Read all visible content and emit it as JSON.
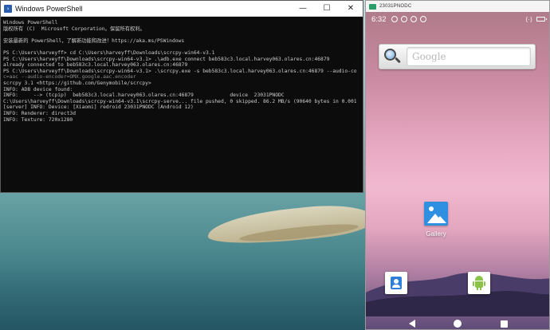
{
  "powershell": {
    "title": "Windows PowerShell",
    "controls": {
      "minimize": "—",
      "maximize": "☐",
      "close": "✕"
    },
    "lines": [
      "Windows PowerShell",
      "版权所有 (C)  Microsoft Corporation。保留所有权利。",
      "",
      "安装最新的 PowerShell，了解新功能和改进！https://aka.ms/PSWindows",
      "",
      "PS C:\\Users\\harveyff> cd C:\\Users\\harveyff\\Downloads\\scrcpy-win64-v3.1",
      "PS C:\\Users\\harveyff\\Downloads\\scrcpy-win64-v3.1> .\\adb.exe connect beb583c3.local.harvey063.olares.cn:46879",
      "already connected to beb583c3.local.harvey063.olares.cn:46879",
      "PS C:\\Users\\harveyff\\Downloads\\scrcpy-win64-v3.1> .\\scrcpy.exe -s beb583c3.local.harvey063.olares.cn:46879 --audio-code",
      "c=aac --audio-encoder=OMX.google.aac.encoder",
      "scrcpy 3.1 <https://github.com/Genymobile/scrcpy>",
      "INFO: ADB device found:",
      "INFO:     --> (tcpip)  beb583c3.local.harvey063.olares.cn:46879            device  23031PNODC",
      "C:\\Users\\harveyff\\Downloads\\scrcpy-win64-v3.1\\scrcpy-serve... file pushed, 0 skipped. 86.2 MB/s (90640 bytes in 0.001s)",
      "[server] INFO: Device: [Xiaomi] redroid 23031PNODC (Android 12)",
      "INFO: Renderer: direct3d",
      "INFO: Texture: 720x1280"
    ]
  },
  "android": {
    "window_title": "23031PNODC",
    "status": {
      "time": "6:32",
      "right_text": "⟨·⟩"
    },
    "search": {
      "placeholder": "Google"
    },
    "apps": {
      "gallery_label": "Gallery"
    }
  }
}
